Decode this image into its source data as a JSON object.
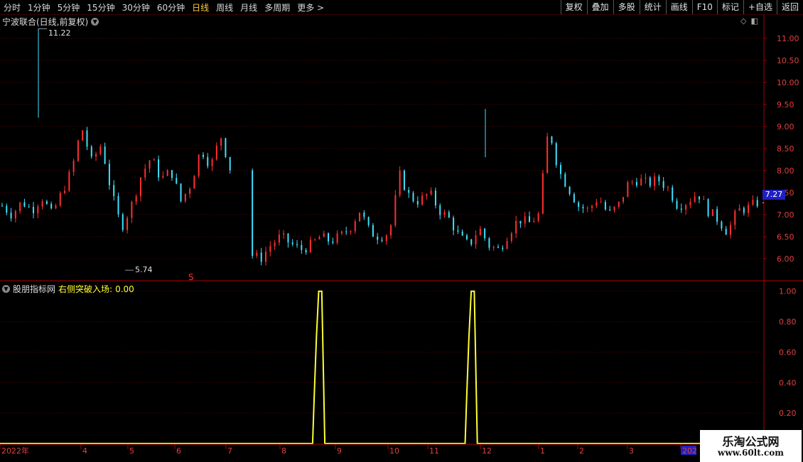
{
  "toolbar": {
    "periods": [
      "分时",
      "1分钟",
      "5分钟",
      "15分钟",
      "30分钟",
      "60分钟",
      "日线",
      "周线",
      "月线",
      "多周期",
      "更多"
    ],
    "active_period": "日线",
    "more_arrow": ">",
    "right_buttons": [
      "复权",
      "叠加",
      "多股",
      "统计",
      "画线",
      "F10",
      "标记",
      "+自选",
      "返回"
    ]
  },
  "price_panel": {
    "title": "宁波联合(日线,前复权)",
    "high_label": "11.22",
    "low_label": "5.74",
    "last_price": "7.27",
    "marker": "S"
  },
  "indicator_panel": {
    "source": "股朋指标网",
    "label": "右侧突破入场:",
    "value": "0.00"
  },
  "watermark": {
    "line1": "乐淘公式网",
    "line2": "www.60lt.com"
  },
  "colors": {
    "up": "#ff3030",
    "down": "#40e0ff",
    "line": "#ffff33",
    "grid": "#6a0000",
    "axis": "#b00000"
  },
  "chart_data": [
    {
      "type": "candlestick",
      "title": "宁波联合(日线,前复权)",
      "ylim": [
        5.5,
        11.5
      ],
      "yticks": [
        6.0,
        6.5,
        7.0,
        7.5,
        8.0,
        8.5,
        9.0,
        9.5,
        10.0,
        10.5,
        11.0
      ],
      "ytick_labels": [
        "6.00",
        "6.50",
        "7.00",
        "7.50",
        "8.00",
        "8.50",
        "9.00",
        "9.50",
        "10.00",
        "10.50",
        "11.00"
      ],
      "max": 11.22,
      "min": 5.74,
      "last": 7.27,
      "close_path": [
        7.2,
        7.0,
        7.3,
        7.1,
        7.4,
        7.0,
        7.5,
        8.0,
        9.0,
        8.2,
        8.6,
        7.5,
        6.7,
        7.2,
        7.9,
        8.3,
        7.8,
        8.0,
        7.3,
        7.7,
        8.5,
        8.1,
        8.8,
        8.0,
        null,
        6.1,
        6.0,
        6.3,
        6.5,
        6.35,
        6.2,
        6.3,
        6.5,
        6.4,
        6.5,
        6.7,
        7.1,
        6.6,
        6.5,
        6.6,
        7.9,
        7.4,
        7.3,
        7.5,
        7.1,
        6.9,
        6.5,
        6.3,
        6.7,
        6.3,
        6.2,
        6.6,
        6.9,
        6.8,
        7.0,
        9.0,
        8.0,
        7.6,
        7.2,
        7.1,
        7.4,
        7.0,
        7.2,
        7.7,
        7.8,
        7.7,
        7.8,
        7.6,
        7.2,
        7.3,
        7.5,
        7.1,
        6.9,
        6.6,
        7.1,
        7.15,
        7.27
      ]
    },
    {
      "type": "line",
      "series": [
        {
          "name": "右侧突破入场",
          "x": [
            0.0,
            0.41,
            0.412,
            0.415,
            0.418,
            0.422,
            0.426,
            0.61,
            0.612,
            0.615,
            0.618,
            0.622,
            0.626,
            1.0
          ],
          "y": [
            0,
            0,
            0.3,
            0.7,
            1.0,
            1.0,
            0,
            0,
            0.3,
            0.7,
            1.0,
            1.0,
            0,
            0
          ]
        }
      ],
      "ylim": [
        0,
        1.05
      ],
      "yticks": [
        0.2,
        0.4,
        0.6,
        0.8,
        1.0
      ],
      "ytick_labels": [
        "0.20",
        "0.40",
        "0.60",
        "0.80",
        "1.00"
      ]
    }
  ],
  "x_axis": {
    "labels": [
      "2022年",
      "4",
      "5",
      "6",
      "7",
      "8",
      "9",
      "10",
      "11",
      "12",
      "1",
      "2",
      "3",
      "202"
    ]
  }
}
